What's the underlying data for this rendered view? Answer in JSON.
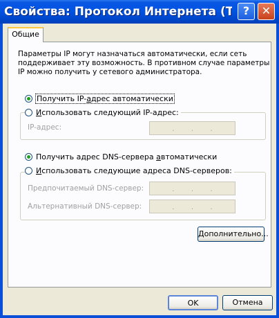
{
  "window": {
    "title": "Свойства: Протокол Интернета (Т...",
    "help_glyph": "?",
    "close_glyph": "✕"
  },
  "tabs": [
    {
      "label": "Общие",
      "active": true
    }
  ],
  "description": [
    "Параметры IP могут назначаться автоматически, если сеть",
    "поддерживает эту возможность. В противном случае параметры",
    "IP можно получить у сетевого администратора."
  ],
  "ip": {
    "auto_label_prefix": "Получить IP-",
    "auto_label_accel": "а",
    "auto_label_suffix": "дрес автоматически",
    "auto_selected": true,
    "manual_label_accel": "И",
    "manual_label_suffix": "спользовать следующий IP-адрес:",
    "manual_selected": false,
    "address_label": "IP-адрес:",
    "dots": [
      ".",
      ".",
      "."
    ]
  },
  "dns": {
    "auto_label_prefix": "Получить адрес DNS-сервера ",
    "auto_label_accel": "а",
    "auto_label_suffix": "втоматически",
    "auto_selected": true,
    "manual_label_accel": "И",
    "manual_label_suffix": "спользовать следующие адреса DNS-серверов:",
    "manual_selected": false,
    "preferred_label": "Предпочитаемый DNS-сервер:",
    "alternate_label": "Альтернативный DNS-сервер:",
    "dots": [
      ".",
      ".",
      "."
    ]
  },
  "buttons": {
    "advanced": "Дополнительно...",
    "ok": "OK",
    "cancel": "Отмена"
  },
  "colors": {
    "titlebar": "#0054e3",
    "dialog_bg": "#ece9d8",
    "tab_accent": "#ffc83c",
    "radio_dot": "#21a121"
  }
}
